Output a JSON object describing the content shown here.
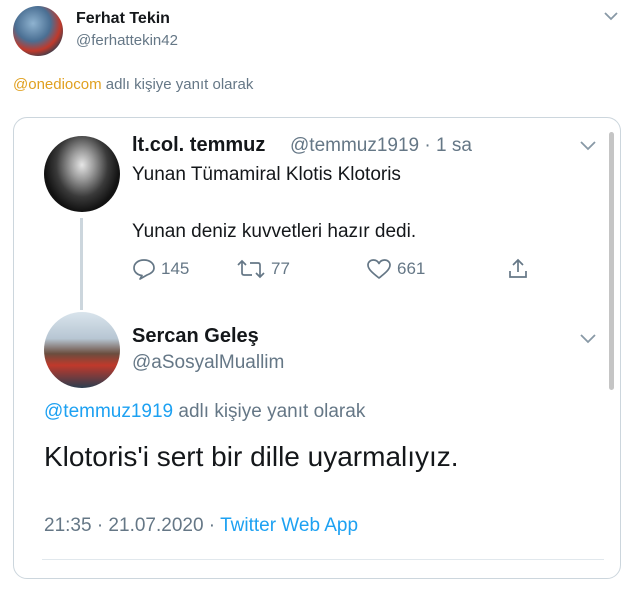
{
  "outer_tweet": {
    "name": "Ferhat Tekin",
    "handle": "@ferhattekin42",
    "reply_mention": "@onediocom",
    "reply_suffix": " adlı kişiye yanıt olarak"
  },
  "parent_tweet": {
    "name": "lt.col. temmuz",
    "meta": "@temmuz1919 · 1 sa",
    "line1": "Yunan Tümamiral Klotis Klotoris",
    "line2": "Yunan deniz kuvvetleri hazır dedi.",
    "actions": {
      "reply_count": "145",
      "retweet_count": "77",
      "like_count": "661"
    }
  },
  "reply_tweet": {
    "name": "Sercan Geleş",
    "handle": "@aSosyalMuallim",
    "reply_mention": "@temmuz1919",
    "reply_suffix": " adlı kişiye yanıt olarak",
    "text": "Klotoris'i sert bir dille uyarmalıyız.",
    "time": "21:35 · 21.07.2020 · ",
    "source": "Twitter Web App"
  },
  "colors": {
    "link_blue": "#1da1f2",
    "mention_gold": "#e0a020",
    "muted": "#657786"
  }
}
